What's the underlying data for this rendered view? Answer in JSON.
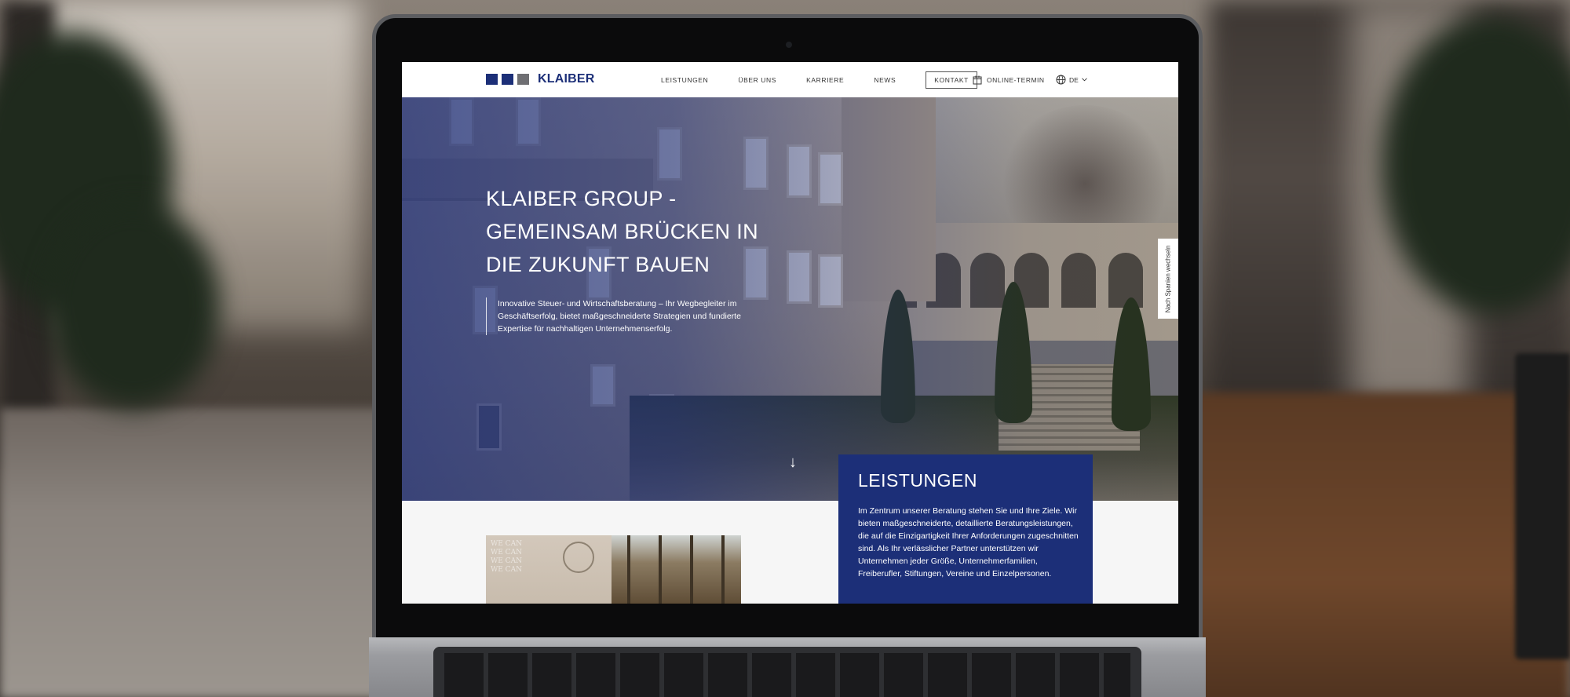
{
  "header": {
    "logo_text": "KLAIBER",
    "logo_colors": [
      "#1c2f78",
      "#1c2f78",
      "#6f6f73"
    ],
    "nav": [
      {
        "label": "LEISTUNGEN"
      },
      {
        "label": "ÜBER UNS"
      },
      {
        "label": "KARRIERE"
      },
      {
        "label": "NEWS"
      },
      {
        "label": "KONTAKT"
      }
    ],
    "online_termin": "ONLINE-TERMIN",
    "online_termin_icon": "calendar-icon",
    "language": "DE",
    "language_icon": "globe-icon"
  },
  "hero": {
    "title": "KLAIBER GROUP - GEMEINSAM BRÜCKEN IN DIE ZUKUNFT BAUEN",
    "subtitle": "Innovative Steuer- und Wirtschaftsberatung – Ihr Wegbegleiter im Geschäftserfolg, bietet maßgeschneiderte Strategien und fundierte Expertise für nachhaltigen Unternehmenserfolg.",
    "scroll_arrow": "↓",
    "side_tab": "Nach Spanien wechseln"
  },
  "services_card": {
    "heading": "LEISTUNGEN",
    "text": "Im Zentrum unserer Beratung stehen Sie und Ihre Ziele. Wir bieten maßgeschneiderte, detaillierte Beratungsleistungen, die auf die Einzigartigkeit Ihrer Anforderungen zugeschnitten sind. Als Ihr verlässlicher Partner unterstützen wir Unternehmen jeder Größe, Unternehmerfamilien, Freiberufler, Stiftungen, Vereine und Einzelpersonen."
  },
  "thumbnail": {
    "wall_text": "WE CAN\nWE CAN\nWE CAN\nWE CAN"
  },
  "colors": {
    "brand_blue": "#1c2f78",
    "header_bg": "#ffffff",
    "page_bg": "#f6f6f6"
  }
}
